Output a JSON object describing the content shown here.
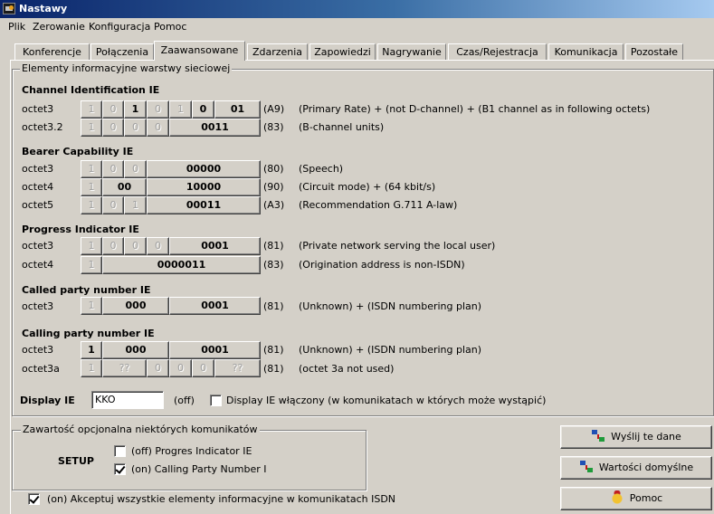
{
  "window": {
    "title": "Nastawy"
  },
  "menu": [
    "Plik",
    "Zerowanie",
    "Konfiguracja",
    "Pomoc"
  ],
  "tabs": [
    {
      "label": "Konferencje",
      "active": false
    },
    {
      "label": "Połączenia",
      "active": false
    },
    {
      "label": "Zaawansowane",
      "active": true
    },
    {
      "label": "Zdarzenia",
      "active": false
    },
    {
      "label": "Zapowiedzi",
      "active": false
    },
    {
      "label": "Nagrywanie",
      "active": false
    },
    {
      "label": "Czas/Rejestracja",
      "active": false
    },
    {
      "label": "Komunikacja",
      "active": false
    },
    {
      "label": "Pozostałe",
      "active": false
    }
  ],
  "ie_group": {
    "title": "Elementy informacyjne warstwy sieciowej",
    "sections": [
      {
        "title": "Channel Identification IE",
        "rows": [
          {
            "label": "octet3",
            "bits": [
              "1",
              "0",
              "1",
              "0",
              "1",
              "0",
              "01"
            ],
            "code": "(A9)",
            "desc": "(Primary Rate) + (not D-channel) + (B1 channel as in following octets)"
          },
          {
            "label": "octet3.2",
            "bits": [
              "1",
              "0",
              "0",
              "0",
              "0011"
            ],
            "code": "(83)",
            "desc": "(B-channel units)"
          }
        ]
      },
      {
        "title": "Bearer Capability IE",
        "rows": [
          {
            "label": "octet3",
            "bits": [
              "1",
              "0",
              "0",
              "00000"
            ],
            "code": "(80)",
            "desc": "(Speech)"
          },
          {
            "label": "octet4",
            "bits": [
              "1",
              "00",
              "10000"
            ],
            "code": "(90)",
            "desc": "(Circuit mode) + (64 kbit/s)"
          },
          {
            "label": "octet5",
            "bits": [
              "1",
              "0",
              "1",
              "00011"
            ],
            "code": "(A3)",
            "desc": "(Recommendation G.711 A-law)"
          }
        ]
      },
      {
        "title": "Progress Indicator IE",
        "rows": [
          {
            "label": "octet3",
            "bits": [
              "1",
              "0",
              "0",
              "0",
              "0001"
            ],
            "code": "(81)",
            "desc": "(Private network serving the local user)"
          },
          {
            "label": "octet4",
            "bits": [
              "1",
              "0000011"
            ],
            "code": "(83)",
            "desc": "(Origination address is non-ISDN)"
          }
        ]
      },
      {
        "title": "Called party number IE",
        "rows": [
          {
            "label": "octet3",
            "bits": [
              "1",
              "000",
              "0001"
            ],
            "code": "(81)",
            "desc": "(Unknown) + (ISDN numbering plan)"
          }
        ]
      },
      {
        "title": "Calling party number IE",
        "rows": [
          {
            "label": "octet3",
            "bits": [
              "1",
              "000",
              "0001"
            ],
            "code": "(81)",
            "desc": "(Unknown) + (ISDN numbering plan)"
          },
          {
            "label": "octet3a",
            "bits": [
              "1",
              "??",
              "0",
              "0",
              "0",
              "??"
            ],
            "code": "(81)",
            "desc": "(octet 3a not used)"
          }
        ]
      }
    ],
    "display": {
      "label": "Display IE",
      "value": "KKO",
      "status": "(off)",
      "checkbox_label": "Display IE włączony (w komunikatach w których może wystąpić)",
      "checked": false
    }
  },
  "optional_group": {
    "title": "Zawartość opcjonalna niektórych komunikatów",
    "setup_label": "SETUP",
    "options": [
      {
        "label": "(off) Progres Indicator IE",
        "checked": false
      },
      {
        "label": "(on) Calling Party Number I",
        "checked": true
      }
    ]
  },
  "accept_all": {
    "label": "(on) Akceptuj wszystkie elementy informacyjne w komunikatach ISDN",
    "checked": true
  },
  "buttons": {
    "send": "Wyślij te dane",
    "defaults": "Wartości domyślne",
    "help": "Pomoc"
  }
}
